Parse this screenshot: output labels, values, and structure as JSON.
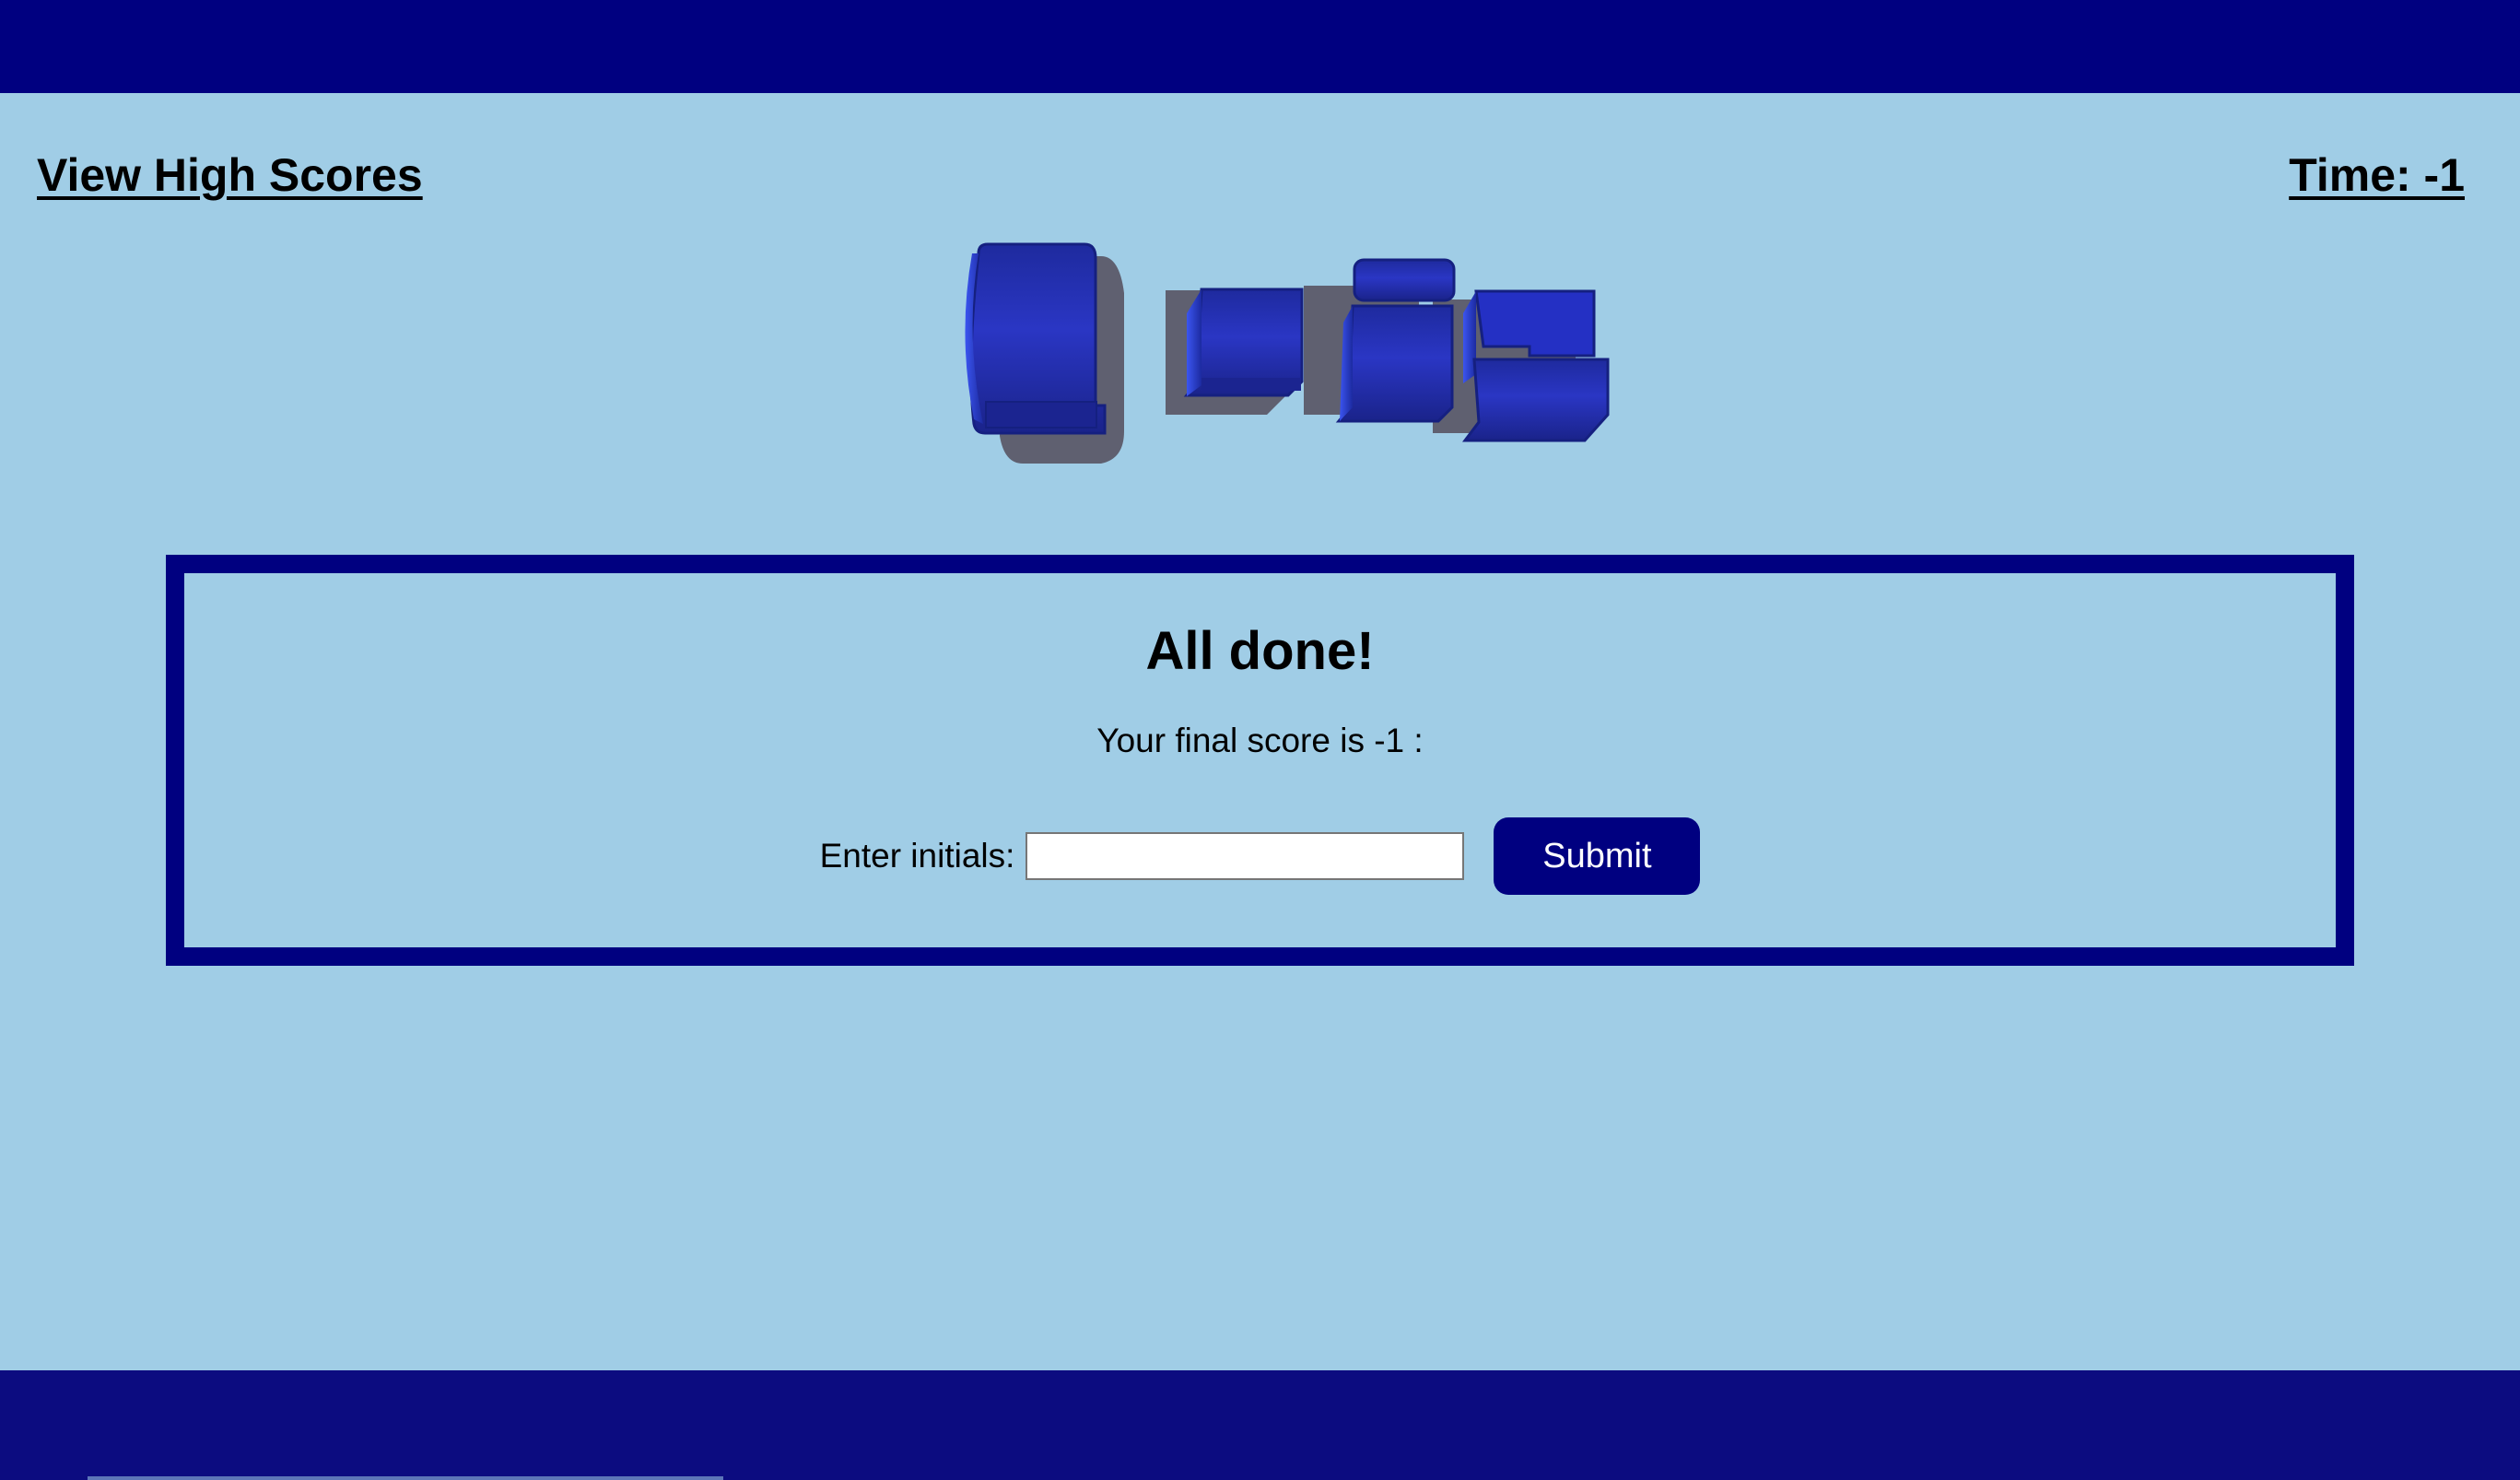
{
  "header": {
    "view_high_scores": "View High Scores",
    "timer": "Time: -1"
  },
  "logo": {
    "text": "Quiz",
    "icon": "quiz-3d-logo"
  },
  "card": {
    "title": "All done!",
    "score_text": "Your final score is -1 :",
    "initials_label": "Enter initials:",
    "initials_value": "",
    "initials_placeholder": "",
    "submit_label": "Submit"
  },
  "colors": {
    "background": "#a0cde6",
    "navy": "#000080",
    "logo_blue": "#2430b8"
  }
}
